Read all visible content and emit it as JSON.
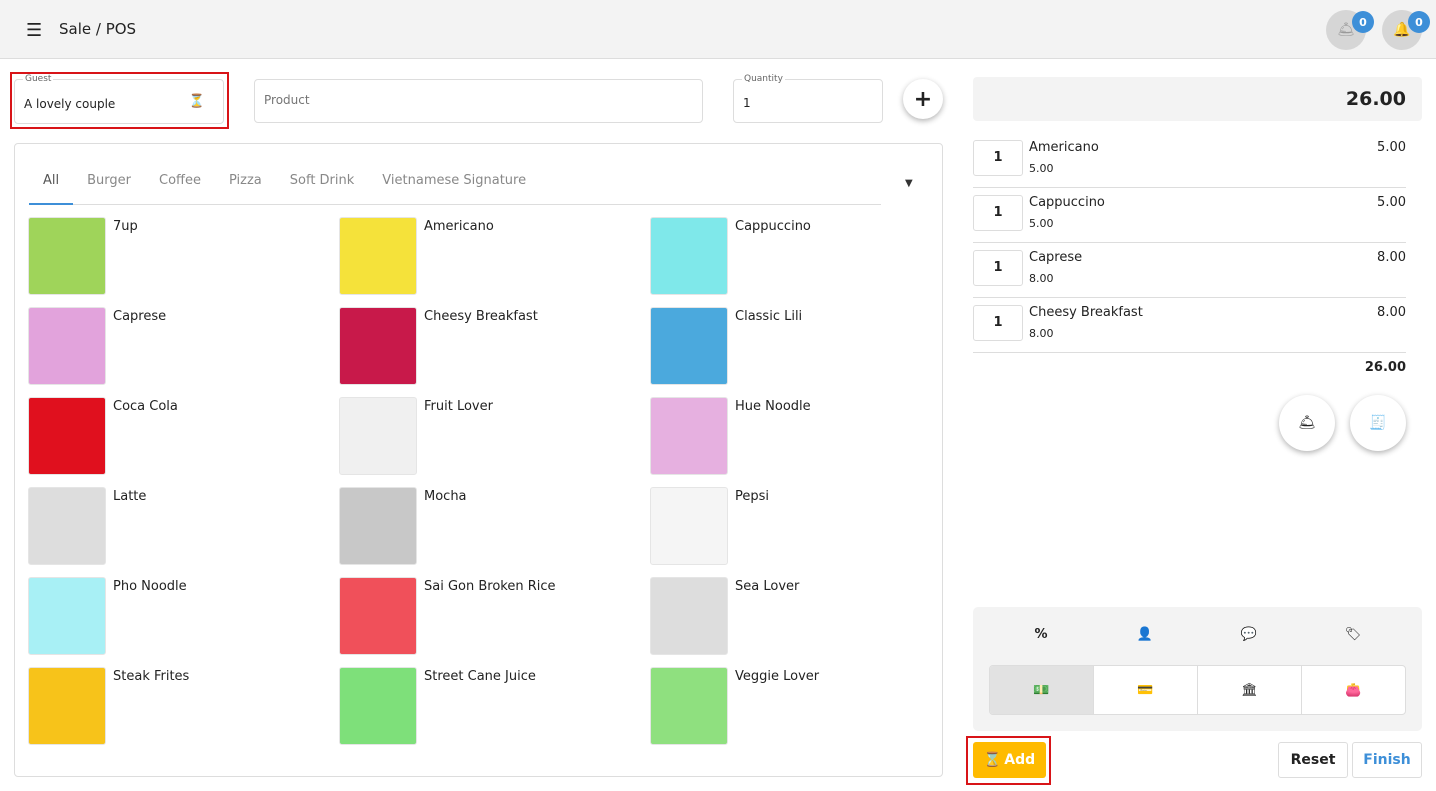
{
  "header": {
    "title": "Sale / POS",
    "badges": [
      "0",
      "0"
    ]
  },
  "guest": {
    "label": "Guest",
    "value": "A lovely couple"
  },
  "product": {
    "placeholder": "Product"
  },
  "quantity": {
    "label": "Quantity",
    "value": "1"
  },
  "tabs": [
    "All",
    "Burger",
    "Coffee",
    "Pizza",
    "Soft Drink",
    "Vietnamese Signature"
  ],
  "products": [
    {
      "name": "7up",
      "color": "#9fd45a"
    },
    {
      "name": "Americano",
      "color": "#f5e23a"
    },
    {
      "name": "Cappuccino",
      "color": "#7fe8ea"
    },
    {
      "name": "Caprese",
      "color": "#e2a3dc"
    },
    {
      "name": "Cheesy Breakfast",
      "color": "#c8194a"
    },
    {
      "name": "Classic Lili",
      "color": "#4ba9dd"
    },
    {
      "name": "Coca Cola",
      "color": "#e0101e"
    },
    {
      "name": "Fruit Lover",
      "color": "#f0f0f0"
    },
    {
      "name": "Hue Noodle",
      "color": "#e6b0e0"
    },
    {
      "name": "Latte",
      "color": "#dddddd"
    },
    {
      "name": "Mocha",
      "color": "#c8c8c8"
    },
    {
      "name": "Pepsi",
      "color": "#f5f5f5"
    },
    {
      "name": "Pho Noodle",
      "color": "#a8f0f5"
    },
    {
      "name": "Sai Gon Broken Rice",
      "color": "#f0505a"
    },
    {
      "name": "Sea Lover",
      "color": "#dddddd"
    },
    {
      "name": "Steak Frites",
      "color": "#f7c31a"
    },
    {
      "name": "Street Cane Juice",
      "color": "#7ee07a"
    },
    {
      "name": "Veggie Lover",
      "color": "#8fe07f"
    }
  ],
  "order": {
    "total": "26.00",
    "subtotal": "26.00",
    "lines": [
      {
        "qty": "1",
        "name": "Americano",
        "price": "5.00",
        "total": "5.00"
      },
      {
        "qty": "1",
        "name": "Cappuccino",
        "price": "5.00",
        "total": "5.00"
      },
      {
        "qty": "1",
        "name": "Caprese",
        "price": "8.00",
        "total": "8.00"
      },
      {
        "qty": "1",
        "name": "Cheesy Breakfast",
        "price": "8.00",
        "total": "8.00"
      }
    ]
  },
  "actions": {
    "add": "Add",
    "reset": "Reset",
    "finish": "Finish"
  },
  "colors": {
    "accent": "#3d8fd8",
    "add": "#ffbb00",
    "highlight": "#d81418"
  }
}
